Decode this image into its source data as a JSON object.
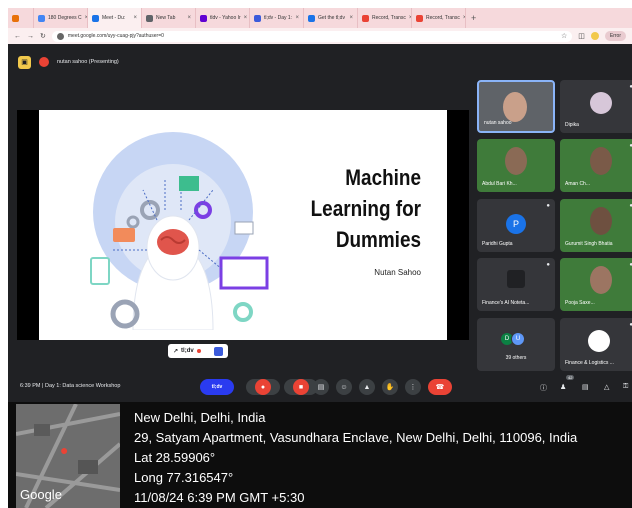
{
  "browser": {
    "tabs": [
      {
        "label": "",
        "color": "#e8710a"
      },
      {
        "label": "180 Degrees C",
        "color": "#4285f4"
      },
      {
        "label": "Meet - Du:",
        "color": "#1a73e8",
        "active": true
      },
      {
        "label": "New Tab",
        "color": "#5f6368"
      },
      {
        "label": "tldv - Yahoo Ir",
        "color": "#6001d2"
      },
      {
        "label": "tl;dv - Day 1:",
        "color": "#3b5bdb"
      },
      {
        "label": "Get the tl;dv",
        "color": "#1a73e8"
      },
      {
        "label": "Record, Transc",
        "color": "#ea4335"
      },
      {
        "label": "Record, Transc",
        "color": "#ea4335"
      }
    ],
    "url": "meet.google.com/uyy-cuag-pjy?authuser=0",
    "error_label": "Error"
  },
  "meet": {
    "presenter": "nutan sahoo (Presenting)",
    "slide": {
      "title": "Machine\nLearning for\nDummies",
      "author": "Nutan Sahoo"
    },
    "tldv_badge": "tl;dv",
    "participants": [
      {
        "name": "nutan sahoo"
      },
      {
        "name": "Dipika"
      },
      {
        "name": "Abdul Bari Kh..."
      },
      {
        "name": "Aman Ch..."
      },
      {
        "name": "Paridhi Gupta",
        "initial": "P"
      },
      {
        "name": "Gurumit Singh Bhatia"
      },
      {
        "name": "Finance's AI Noteta..."
      },
      {
        "name": "Pooja Saxe..."
      },
      {
        "name": "39 others",
        "initials": [
          "D",
          "U"
        ]
      },
      {
        "name": "Finance & Logistics ..."
      }
    ],
    "meeting_info": "6:39 PM  |  Day 1: Data science Workshop",
    "tldv_control": "tl;dv",
    "people_count": "42"
  },
  "geo": {
    "city": "New Delhi, Delhi, India",
    "address": "29, Satyam Apartment, Vasundhara Enclave, New Delhi, Delhi, 110096, India",
    "lat": "Lat 28.59906°",
    "long": "Long 77.316547°",
    "datetime": "11/08/24 6:39 PM GMT +5:30",
    "map_brand": "Google"
  }
}
